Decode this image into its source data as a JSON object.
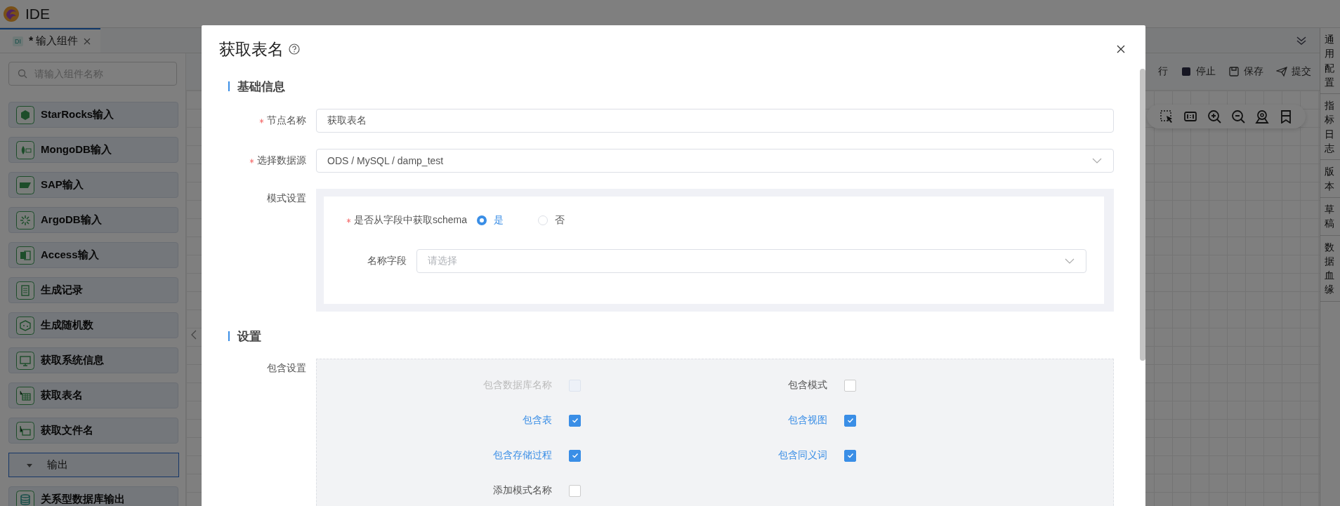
{
  "app": {
    "title": "IDE"
  },
  "tabs": [
    {
      "badge": "DI",
      "prefix": "*",
      "label": "输入组件",
      "selected": true
    }
  ],
  "search": {
    "placeholder": "请输入组件名称"
  },
  "components": [
    {
      "kind": "item",
      "label": "StarRocks输入"
    },
    {
      "kind": "item",
      "label": "MongoDB输入"
    },
    {
      "kind": "item",
      "label": "SAP输入"
    },
    {
      "kind": "item",
      "label": "ArgoDB输入"
    },
    {
      "kind": "item",
      "label": "Access输入"
    },
    {
      "kind": "item",
      "label": "生成记录"
    },
    {
      "kind": "item",
      "label": "生成随机数"
    },
    {
      "kind": "item",
      "label": "获取系统信息"
    },
    {
      "kind": "item",
      "label": "获取表名"
    },
    {
      "kind": "item",
      "label": "获取文件名"
    },
    {
      "kind": "group",
      "label": "输出",
      "expanded": true
    },
    {
      "kind": "item",
      "label": "关系型数据库输出"
    }
  ],
  "toolbar": [
    {
      "label": "行"
    },
    {
      "label": "停止"
    },
    {
      "label": "保存"
    },
    {
      "label": "提交"
    }
  ],
  "right_panel": [
    {
      "label": "通用配置"
    },
    {
      "label": "指标日志"
    },
    {
      "label": "版本"
    },
    {
      "label": "草稿"
    },
    {
      "label": "数据血缘"
    }
  ],
  "dialog": {
    "title": "获取表名",
    "sections": [
      {
        "title": "基础信息",
        "fields": [
          {
            "kind": "input",
            "label": "节点名称",
            "required": true,
            "value": "获取表名"
          },
          {
            "kind": "select",
            "label": "选择数据源",
            "required": true,
            "value": "ODS / MySQL / damp_test"
          },
          {
            "kind": "group",
            "label": "模式设置",
            "required": false,
            "radio": {
              "label": "是否从字段中获取schema",
              "required": true,
              "options": [
                {
                  "label": "是",
                  "selected": true
                },
                {
                  "label": "否",
                  "selected": false
                }
              ]
            },
            "field": {
              "label": "名称字段",
              "placeholder": "请选择"
            }
          }
        ]
      },
      {
        "title": "设置",
        "fields": [
          {
            "kind": "checks",
            "label": "包含设置",
            "required": false,
            "options": [
              {
                "label": "包含数据库名称",
                "checked": false,
                "disabled": true
              },
              {
                "label": "包含模式",
                "checked": false,
                "disabled": false
              },
              {
                "label": "包含表",
                "checked": true,
                "disabled": false
              },
              {
                "label": "包含视图",
                "checked": true,
                "disabled": false
              },
              {
                "label": "包含存储过程",
                "checked": true,
                "disabled": false
              },
              {
                "label": "包含同义词",
                "checked": true,
                "disabled": false
              },
              {
                "label": "添加模式名称",
                "checked": false,
                "disabled": false
              }
            ]
          }
        ]
      }
    ]
  }
}
